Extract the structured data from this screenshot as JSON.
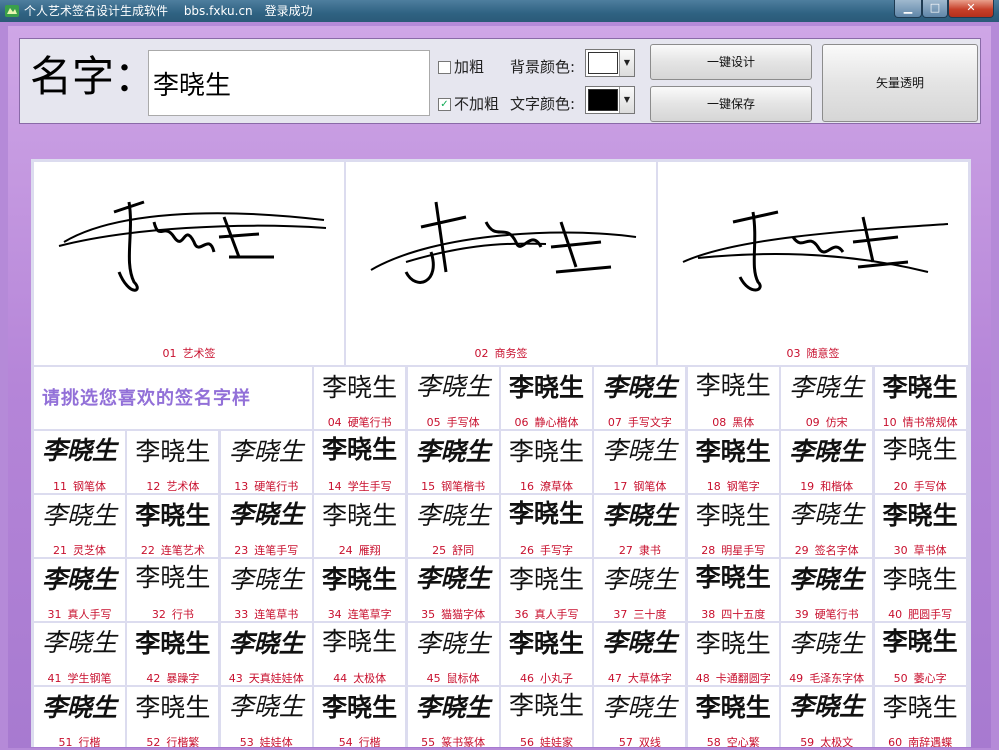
{
  "window": {
    "title": "个人艺术签名设计生成软件　 bbs.fxku.cn　登录成功",
    "buttons": {
      "minimize": "▁",
      "maximize": "□",
      "close": "✕"
    }
  },
  "toolbar": {
    "name_label": "名字：",
    "name_value": "李晓生",
    "bold_label": "加粗",
    "bold_checked": false,
    "nobold_label": "不加粗",
    "nobold_checked": true,
    "bg_color_label": "背景颜色:",
    "bg_color": "#ffffff",
    "text_color_label": "文字颜色:",
    "text_color": "#000000",
    "design_button": "一键设计",
    "save_button": "一键保存",
    "vector_button": "矢量透明"
  },
  "promo_text": "请挑选您喜欢的签名字样",
  "signature_text": "李晓生",
  "featured": [
    {
      "num": "01",
      "name": "艺术签"
    },
    {
      "num": "02",
      "name": "商务签"
    },
    {
      "num": "03",
      "name": "随意签"
    }
  ],
  "styles": [
    {
      "num": "04",
      "name": "硬笔行书"
    },
    {
      "num": "05",
      "name": "手写体"
    },
    {
      "num": "06",
      "name": "静心楷体"
    },
    {
      "num": "07",
      "name": "手写文字"
    },
    {
      "num": "08",
      "name": "黑体"
    },
    {
      "num": "09",
      "name": "仿宋"
    },
    {
      "num": "10",
      "name": "情书常规体"
    },
    {
      "num": "11",
      "name": "钢笔体"
    },
    {
      "num": "12",
      "name": "艺术体"
    },
    {
      "num": "13",
      "name": "硬笔行书"
    },
    {
      "num": "14",
      "name": "学生手写"
    },
    {
      "num": "15",
      "name": "钢笔楷书"
    },
    {
      "num": "16",
      "name": "潦草体"
    },
    {
      "num": "17",
      "name": "钢笔体"
    },
    {
      "num": "18",
      "name": "钢笔字"
    },
    {
      "num": "19",
      "name": "和楷体"
    },
    {
      "num": "20",
      "name": "手写体"
    },
    {
      "num": "21",
      "name": "灵芝体"
    },
    {
      "num": "22",
      "name": "连笔艺术"
    },
    {
      "num": "23",
      "name": "连笔手写"
    },
    {
      "num": "24",
      "name": "雁翔"
    },
    {
      "num": "25",
      "name": "舒同"
    },
    {
      "num": "26",
      "name": "手写字"
    },
    {
      "num": "27",
      "name": "隶书"
    },
    {
      "num": "28",
      "name": "明星手写"
    },
    {
      "num": "29",
      "name": "签名字体"
    },
    {
      "num": "30",
      "name": "草书体"
    },
    {
      "num": "31",
      "name": "真人手写"
    },
    {
      "num": "32",
      "name": "行书"
    },
    {
      "num": "33",
      "name": "连笔草书"
    },
    {
      "num": "34",
      "name": "连笔草字"
    },
    {
      "num": "35",
      "name": "猫猫字体"
    },
    {
      "num": "36",
      "name": "真人手写"
    },
    {
      "num": "37",
      "name": "三十度"
    },
    {
      "num": "38",
      "name": "四十五度"
    },
    {
      "num": "39",
      "name": "硬笔行书"
    },
    {
      "num": "40",
      "name": "肥圆手写"
    },
    {
      "num": "41",
      "name": "学生钢笔"
    },
    {
      "num": "42",
      "name": "暴躁字"
    },
    {
      "num": "43",
      "name": "天真娃娃体"
    },
    {
      "num": "44",
      "name": "太极体"
    },
    {
      "num": "45",
      "name": "鼠标体"
    },
    {
      "num": "46",
      "name": "小丸子"
    },
    {
      "num": "47",
      "name": "大草体字"
    },
    {
      "num": "48",
      "name": "卡通翻圆字"
    },
    {
      "num": "49",
      "name": "毛泽东字体"
    },
    {
      "num": "50",
      "name": "萎心字"
    },
    {
      "num": "51",
      "name": "行楷"
    },
    {
      "num": "52",
      "name": "行楷繁"
    },
    {
      "num": "53",
      "name": "娃娃体"
    },
    {
      "num": "54",
      "name": "行楷"
    },
    {
      "num": "55",
      "name": "篆书篆体"
    },
    {
      "num": "56",
      "name": "娃娃家"
    },
    {
      "num": "57",
      "name": "双线"
    },
    {
      "num": "58",
      "name": "空心繁"
    },
    {
      "num": "59",
      "name": "太极文"
    },
    {
      "num": "60",
      "name": "南辞遇蝶"
    }
  ]
}
